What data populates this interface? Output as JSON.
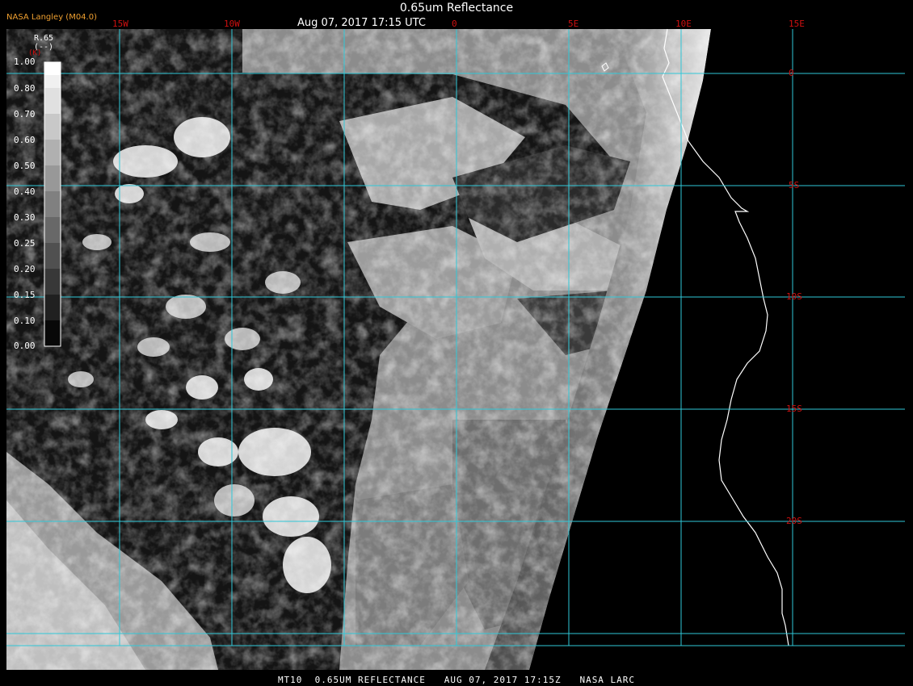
{
  "header": {
    "title": "0.65um Reflectance",
    "datetime": "Aug 07, 2017 17:15 UTC",
    "producer": "NASA Langley (M04.0)"
  },
  "colorbar": {
    "name": "R.65",
    "units": "(--)",
    "extra": "(K)",
    "ticks": [
      "1.00",
      "0.80",
      "0.70",
      "0.60",
      "0.50",
      "0.40",
      "0.30",
      "0.25",
      "0.20",
      "0.15",
      "0.10",
      "0.00"
    ]
  },
  "grid": {
    "lon_labels": [
      "15W",
      "10W",
      "0",
      "5E",
      "10E",
      "15E"
    ],
    "lat_labels": [
      "0",
      "5S",
      "10S",
      "15S",
      "20S"
    ]
  },
  "footer": {
    "text": "MT10  0.65UM REFLECTANCE   AUG 07, 2017 17:15Z   NASA LARC"
  },
  "colors": {
    "grid_line": "#30c8d8",
    "grid_label": "#d01010",
    "coastline": "#ffffff",
    "producer_text": "#f0a030"
  }
}
